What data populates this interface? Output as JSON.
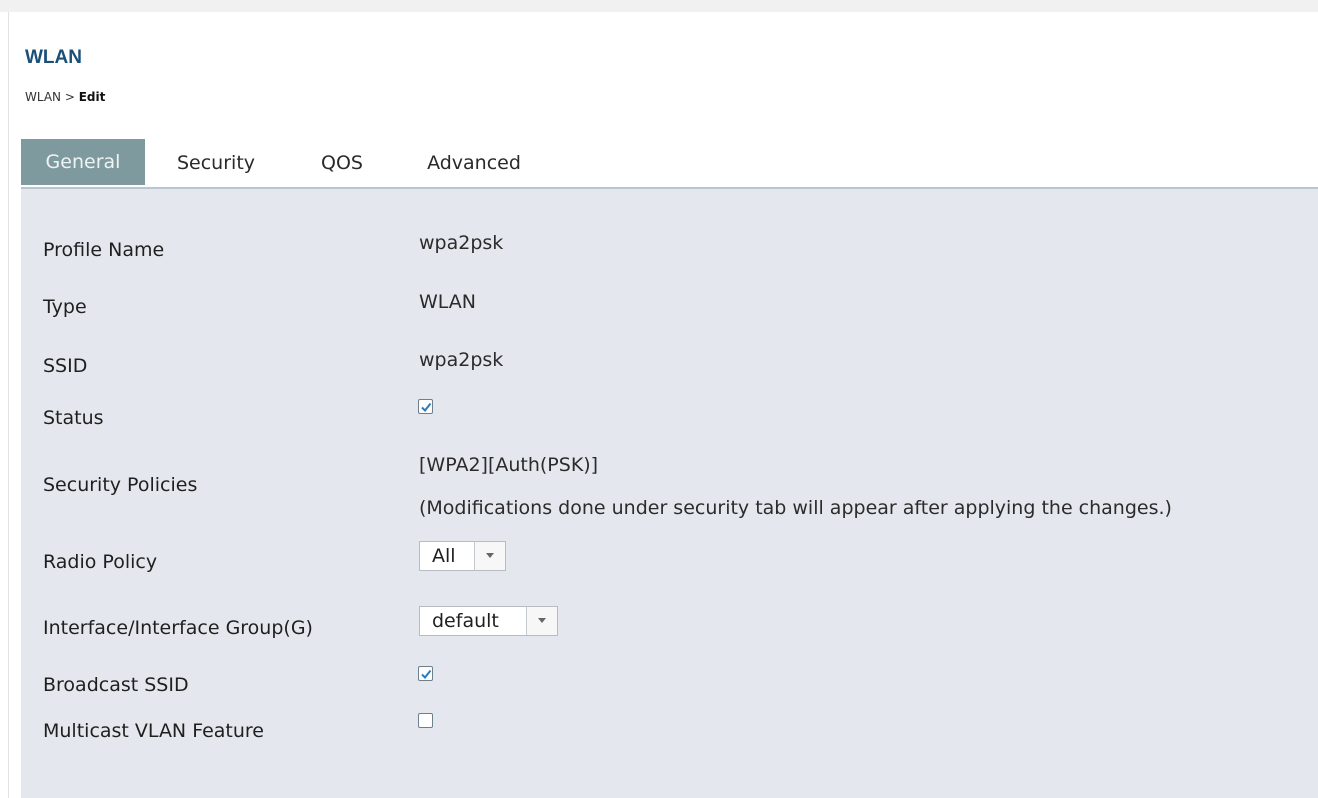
{
  "header": {
    "title": "WLAN",
    "breadcrumb_parent": "WLAN",
    "breadcrumb_separator": ">",
    "breadcrumb_current": "Edit"
  },
  "tabs": [
    {
      "label": "General",
      "active": true
    },
    {
      "label": "Security",
      "active": false
    },
    {
      "label": "QOS",
      "active": false
    },
    {
      "label": "Advanced",
      "active": false
    }
  ],
  "form": {
    "profile_name": {
      "label": "Profile Name",
      "value": "wpa2psk"
    },
    "type": {
      "label": "Type",
      "value": "WLAN"
    },
    "ssid": {
      "label": "SSID",
      "value": "wpa2psk"
    },
    "status": {
      "label": "Status",
      "checked": true
    },
    "security_policies": {
      "label": "Security Policies",
      "value": "[WPA2][Auth(PSK)]",
      "note": "(Modifications done under security tab will appear after applying the changes.)"
    },
    "radio_policy": {
      "label": "Radio Policy",
      "value": "All"
    },
    "interface_group": {
      "label": "Interface/Interface Group(G)",
      "value": "default"
    },
    "broadcast_ssid": {
      "label": "Broadcast SSID",
      "checked": true
    },
    "multicast_vlan": {
      "label": "Multicast VLAN Feature",
      "checked": false
    }
  },
  "colors": {
    "title": "#1a4f78",
    "active_tab": "#7f9a9f",
    "panel": "#e4e8ee",
    "check": "#2a7ac0"
  }
}
